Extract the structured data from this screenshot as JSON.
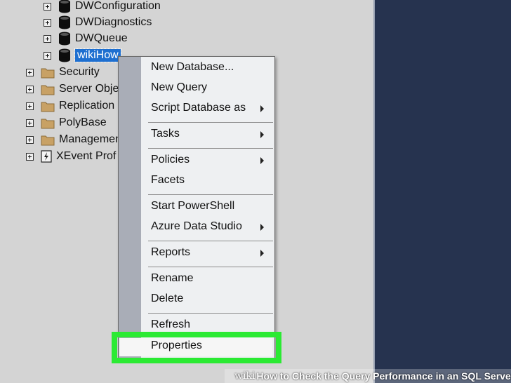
{
  "tree": {
    "items": [
      {
        "label": "DWConfiguration",
        "icon": "database-icon"
      },
      {
        "label": "DWDiagnostics",
        "icon": "database-icon"
      },
      {
        "label": "DWQueue",
        "icon": "database-icon"
      },
      {
        "label": "wikiHow",
        "icon": "database-icon",
        "selected": true
      },
      {
        "label": "Security",
        "icon": "folder-icon"
      },
      {
        "label": "Server Objec",
        "icon": "folder-icon"
      },
      {
        "label": "Replication",
        "icon": "folder-icon"
      },
      {
        "label": "PolyBase",
        "icon": "folder-icon"
      },
      {
        "label": "Managemen",
        "icon": "folder-icon"
      },
      {
        "label": "XEvent Prof",
        "icon": "xevent-icon"
      }
    ]
  },
  "context_menu": {
    "items": [
      {
        "label": "New Database...",
        "has_submenu": false
      },
      {
        "label": "New Query",
        "has_submenu": false
      },
      {
        "label": "Script Database as",
        "has_submenu": true
      },
      {
        "label": "Tasks",
        "has_submenu": true
      },
      {
        "label": "Policies",
        "has_submenu": true
      },
      {
        "label": "Facets",
        "has_submenu": false
      },
      {
        "label": "Start PowerShell",
        "has_submenu": false
      },
      {
        "label": "Azure Data Studio",
        "has_submenu": true
      },
      {
        "label": "Reports",
        "has_submenu": true
      },
      {
        "label": "Rename",
        "has_submenu": false
      },
      {
        "label": "Delete",
        "has_submenu": false
      },
      {
        "label": "Refresh",
        "has_submenu": false
      },
      {
        "label": "Properties",
        "has_submenu": false,
        "highlighted": true
      }
    ]
  },
  "colors": {
    "highlight_box": "#2bea33",
    "selection": "#1e6fd0",
    "right_pane": "#26334f",
    "folder": "#c8a165"
  },
  "watermark": {
    "brand": "wiki",
    "text": "How to Check the Query Performance in an SQL Server"
  }
}
